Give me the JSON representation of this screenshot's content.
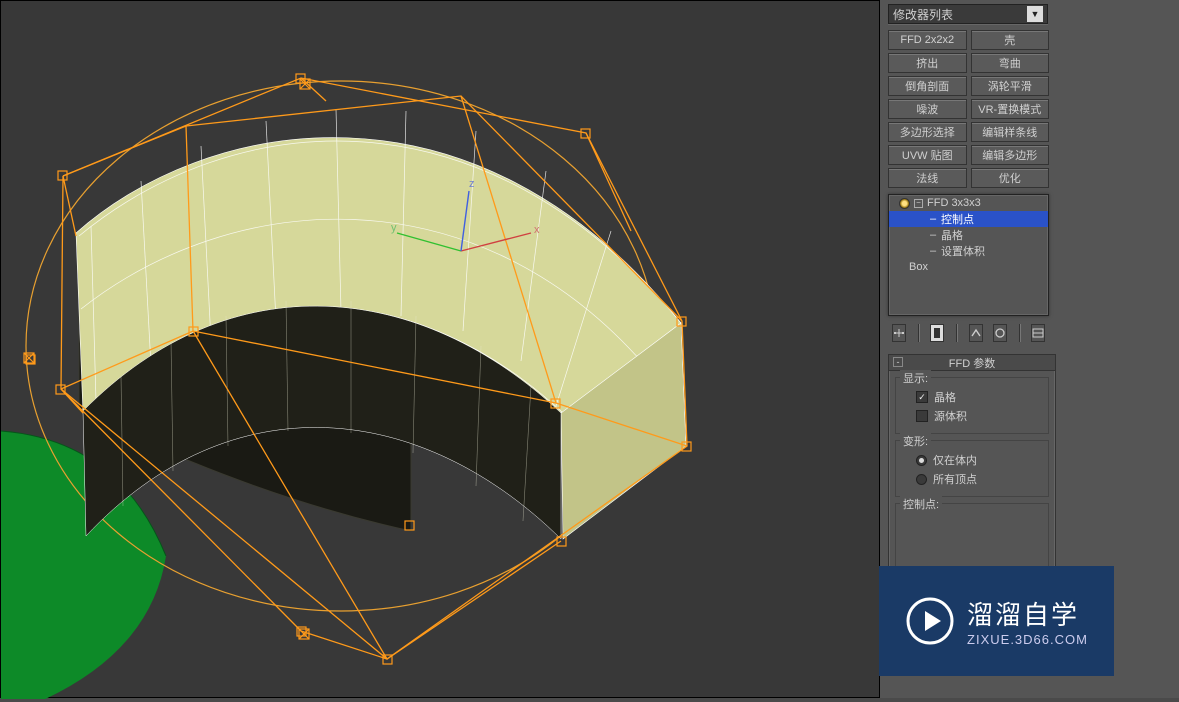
{
  "modifier_list_label": "修改器列表",
  "modifier_buttons": [
    "FFD 2x2x2",
    "壳",
    "挤出",
    "弯曲",
    "倒角剖面",
    "涡轮平滑",
    "噪波",
    "VR-置换模式",
    "多边形选择",
    "编辑样条线",
    "UVW 贴图",
    "编辑多边形",
    "法线",
    "优化"
  ],
  "stack": {
    "items": [
      {
        "label": "FFD 3x3x3",
        "level": 0,
        "selected": false,
        "hasBulb": true,
        "hasExpand": true
      },
      {
        "label": "控制点",
        "level": 1,
        "selected": true
      },
      {
        "label": "晶格",
        "level": 1,
        "selected": false
      },
      {
        "label": "设置体积",
        "level": 1,
        "selected": false
      },
      {
        "label": "Box",
        "level": 0,
        "selected": false
      }
    ]
  },
  "rollout_title": "FFD 参数",
  "group_display": {
    "title": "显示:",
    "lattice": {
      "label": "晶格",
      "checked": true
    },
    "source_volume": {
      "label": "源体积",
      "checked": false
    }
  },
  "group_deform": {
    "title": "变形:",
    "only_in_volume": {
      "label": "仅在体内",
      "checked": true
    },
    "all_vertices": {
      "label": "所有顶点",
      "checked": false
    }
  },
  "group_control_points": {
    "title": "控制点:"
  },
  "watermark": {
    "title": "溜溜自学",
    "sub": "ZIXUE.3D66.COM"
  },
  "axes": {
    "x": "x",
    "y": "y",
    "z": "z"
  }
}
